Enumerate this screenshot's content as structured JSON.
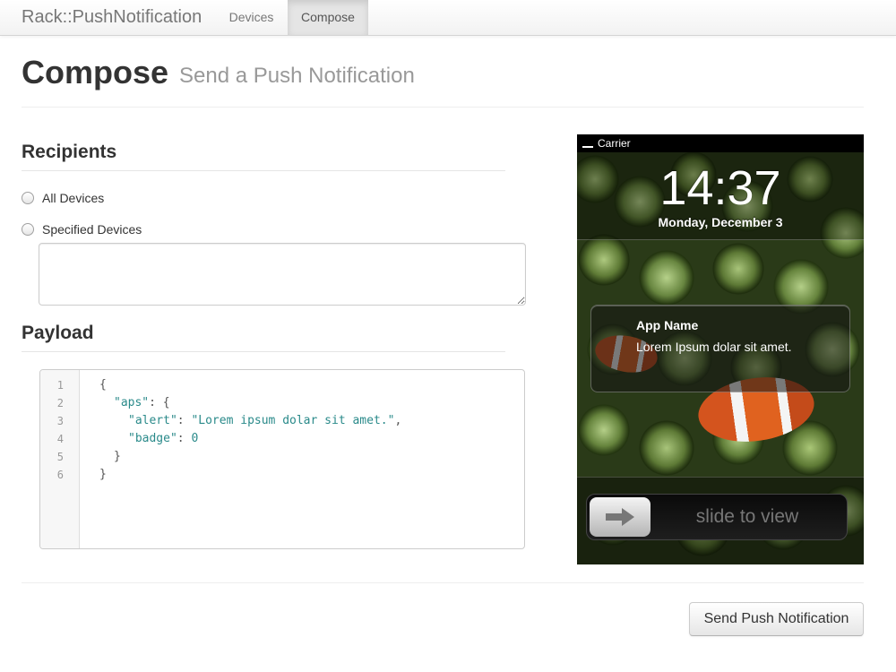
{
  "navbar": {
    "brand": "Rack::PushNotification",
    "tabs": [
      {
        "label": "Devices",
        "active": false
      },
      {
        "label": "Compose",
        "active": true
      }
    ]
  },
  "header": {
    "title": "Compose",
    "subtitle": "Send a Push Notification"
  },
  "recipients": {
    "heading": "Recipients",
    "options": [
      {
        "label": "All Devices",
        "checked": false
      },
      {
        "label": "Specified Devices",
        "checked": false
      }
    ],
    "device_tokens": ""
  },
  "payload": {
    "heading": "Payload",
    "line_numbers": [
      "1",
      "2",
      "3",
      "4",
      "5",
      "6"
    ],
    "lines": {
      "l1": "{",
      "l2_key": "\"aps\"",
      "l2_rest": ": {",
      "l3_key": "\"alert\"",
      "l3_sep": ": ",
      "l3_value": "\"Lorem ipsum dolar sit amet.\"",
      "l3_end": ",",
      "l4_key": "\"badge\"",
      "l4_sep": ": ",
      "l4_value": "0",
      "l5": "}",
      "l6": "}"
    }
  },
  "phone_preview": {
    "carrier": "Carrier",
    "time": "14:37",
    "date": "Monday, December 3",
    "notification": {
      "app_name": "App Name",
      "message": "Lorem Ipsum dolar sit amet."
    },
    "slider_text": "slide to view"
  },
  "actions": {
    "send_label": "Send Push Notification"
  },
  "colors": {
    "code_string": "#2a8a8a",
    "active_tab_bg": "#e5e5e5",
    "muted_text": "#999999"
  }
}
